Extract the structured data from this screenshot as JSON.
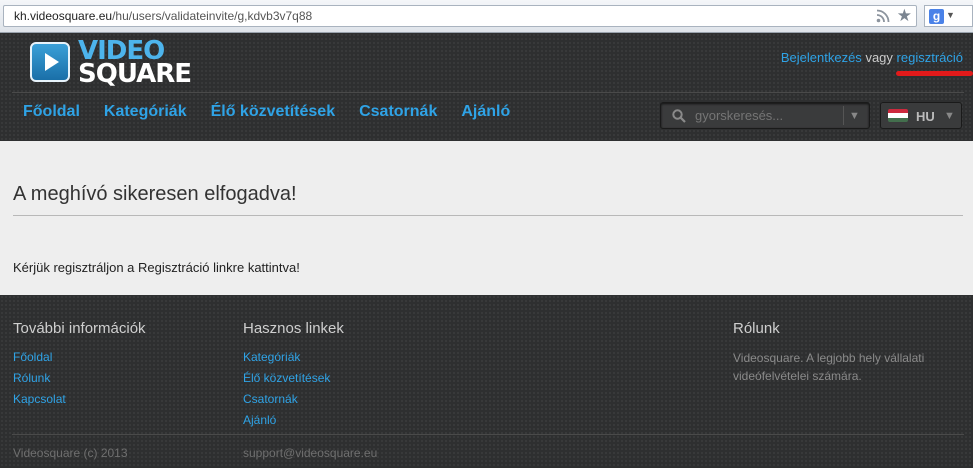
{
  "browser": {
    "url_host": "kh.videosquare.eu",
    "url_path": "/hu/users/validateinvite/g,kdvb3v7q88",
    "search_engine_letter": "g"
  },
  "header": {
    "logo_line1": "VIDEO",
    "logo_line2": "SQUARE",
    "login_link": "Bejelentkezés",
    "or_text": "vagy",
    "register_link": "regisztráció",
    "nav": [
      "Főoldal",
      "Kategóriák",
      "Élő közvetítések",
      "Csatornák",
      "Ajánló"
    ],
    "search_placeholder": "gyorskeresés...",
    "language": "HU",
    "colors": {
      "link": "#2fa3e6",
      "annotation": "#e21a1a"
    }
  },
  "content": {
    "title": "A meghívó sikeresen elfogadva!",
    "message": "Kérjük regisztráljon a Regisztráció linkre kattintva!"
  },
  "footer": {
    "col1_title": "További információk",
    "col1_links": [
      "Főoldal",
      "Rólunk",
      "Kapcsolat"
    ],
    "col2_title": "Hasznos linkek",
    "col2_links": [
      "Kategóriák",
      "Élő közvetítések",
      "Csatornák",
      "Ajánló"
    ],
    "col3_title": "Rólunk",
    "col3_text": "Videosquare. A legjobb hely vállalati videófelvételei számára.",
    "copyright": "Videosquare (c) 2013",
    "support_email": "support@videosquare.eu"
  }
}
